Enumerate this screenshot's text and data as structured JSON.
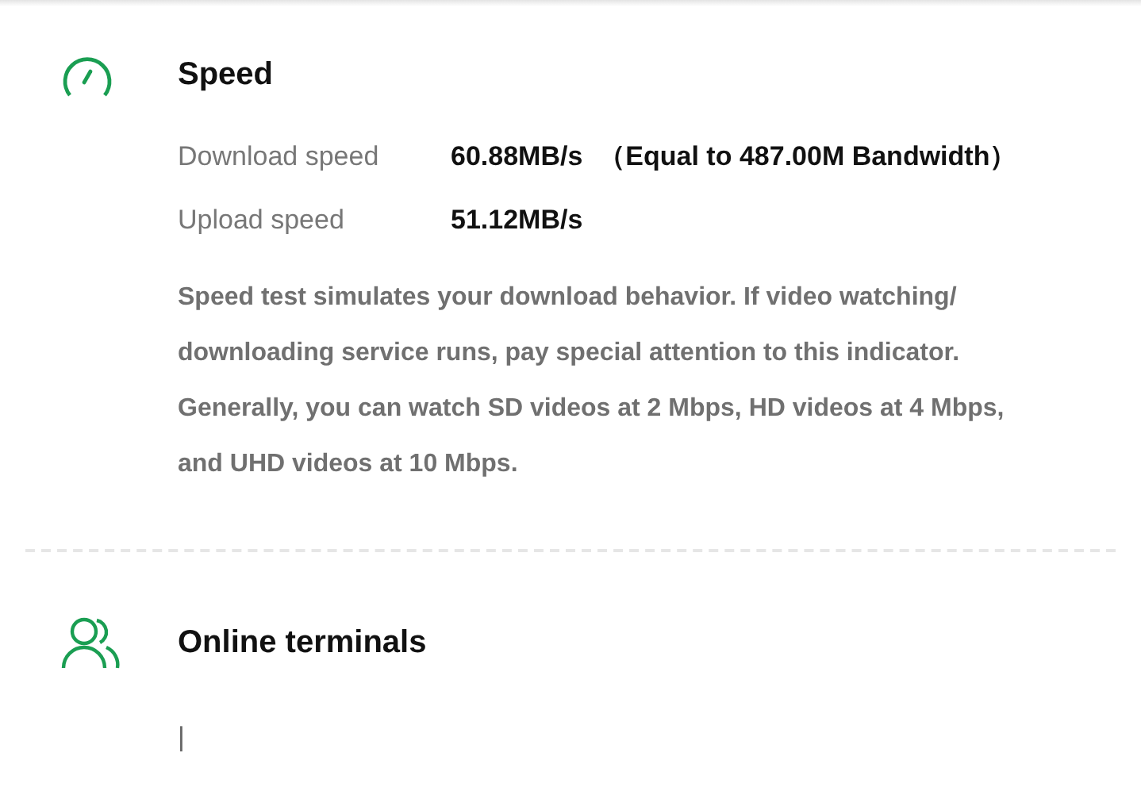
{
  "sections": [
    {
      "kind": "speed",
      "title": "Speed",
      "rows": [
        {
          "label": "Download speed",
          "value": "60.88MB/s",
          "note": "（Equal to 487.00M Bandwidth）"
        },
        {
          "label": "Upload speed",
          "value": "51.12MB/s"
        }
      ],
      "description": "Speed test simulates your download behavior. If video watching/ downloading service runs, pay special attention to this indicator. Generally, you can watch SD videos at 2 Mbps, HD videos at 4 Mbps, and UHD videos at 10 Mbps."
    },
    {
      "kind": "terminals",
      "title": "Online terminals",
      "content": "|"
    }
  ]
}
